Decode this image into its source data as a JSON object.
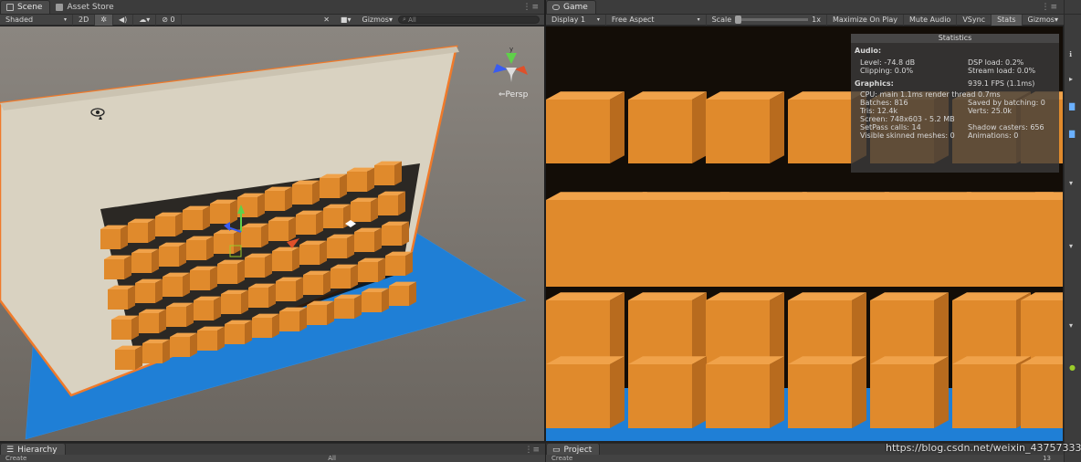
{
  "scene_panel": {
    "tabs": [
      {
        "label": "Scene"
      },
      {
        "label": "Asset Store"
      }
    ],
    "toolbar": {
      "shading": "Shaded",
      "mode_2d": "2D",
      "gizmos": "Gizmos",
      "search_placeholder": "All",
      "count": "0"
    },
    "persp_label": "Persp"
  },
  "game_panel": {
    "tab": {
      "label": "Game"
    },
    "toolbar": {
      "display": "Display 1",
      "aspect": "Free Aspect",
      "scale_label": "Scale",
      "scale_value": "1x",
      "maximize": "Maximize On Play",
      "mute": "Mute Audio",
      "vsync": "VSync",
      "stats": "Stats",
      "gizmos": "Gizmos"
    }
  },
  "statistics": {
    "title": "Statistics",
    "audio_header": "Audio:",
    "level": "Level: -74.8 dB",
    "dsp_load": "DSP load: 0.2%",
    "clipping": "Clipping: 0.0%",
    "stream_load": "Stream load: 0.0%",
    "graphics_header": "Graphics:",
    "fps": "939.1 FPS (1.1ms)",
    "cpu": "CPU: main 1.1ms  render thread 0.7ms",
    "batches": "Batches: 816",
    "saved_batching": "Saved by batching: 0",
    "tris": "Tris: 12.4k",
    "verts": "Verts: 25.0k",
    "screen": "Screen: 748x603 - 5.2 MB",
    "setpass": "SetPass calls: 14",
    "shadow_casters": "Shadow casters: 656",
    "skinned": "Visible skinned meshes: 0",
    "animations": "Animations: 0"
  },
  "hierarchy_panel": {
    "tab": {
      "label": "Hierarchy"
    },
    "create": "Create",
    "search_placeholder": "All"
  },
  "project_panel": {
    "tab": {
      "label": "Project"
    },
    "create": "Create",
    "count": "13"
  },
  "watermark": "https://blog.csdn.net/weixin_43757333",
  "colors": {
    "box": "#e08a2c",
    "plane": "#1f7fd6",
    "wall": "#d9d2c1",
    "selection": "#f07a2a"
  }
}
